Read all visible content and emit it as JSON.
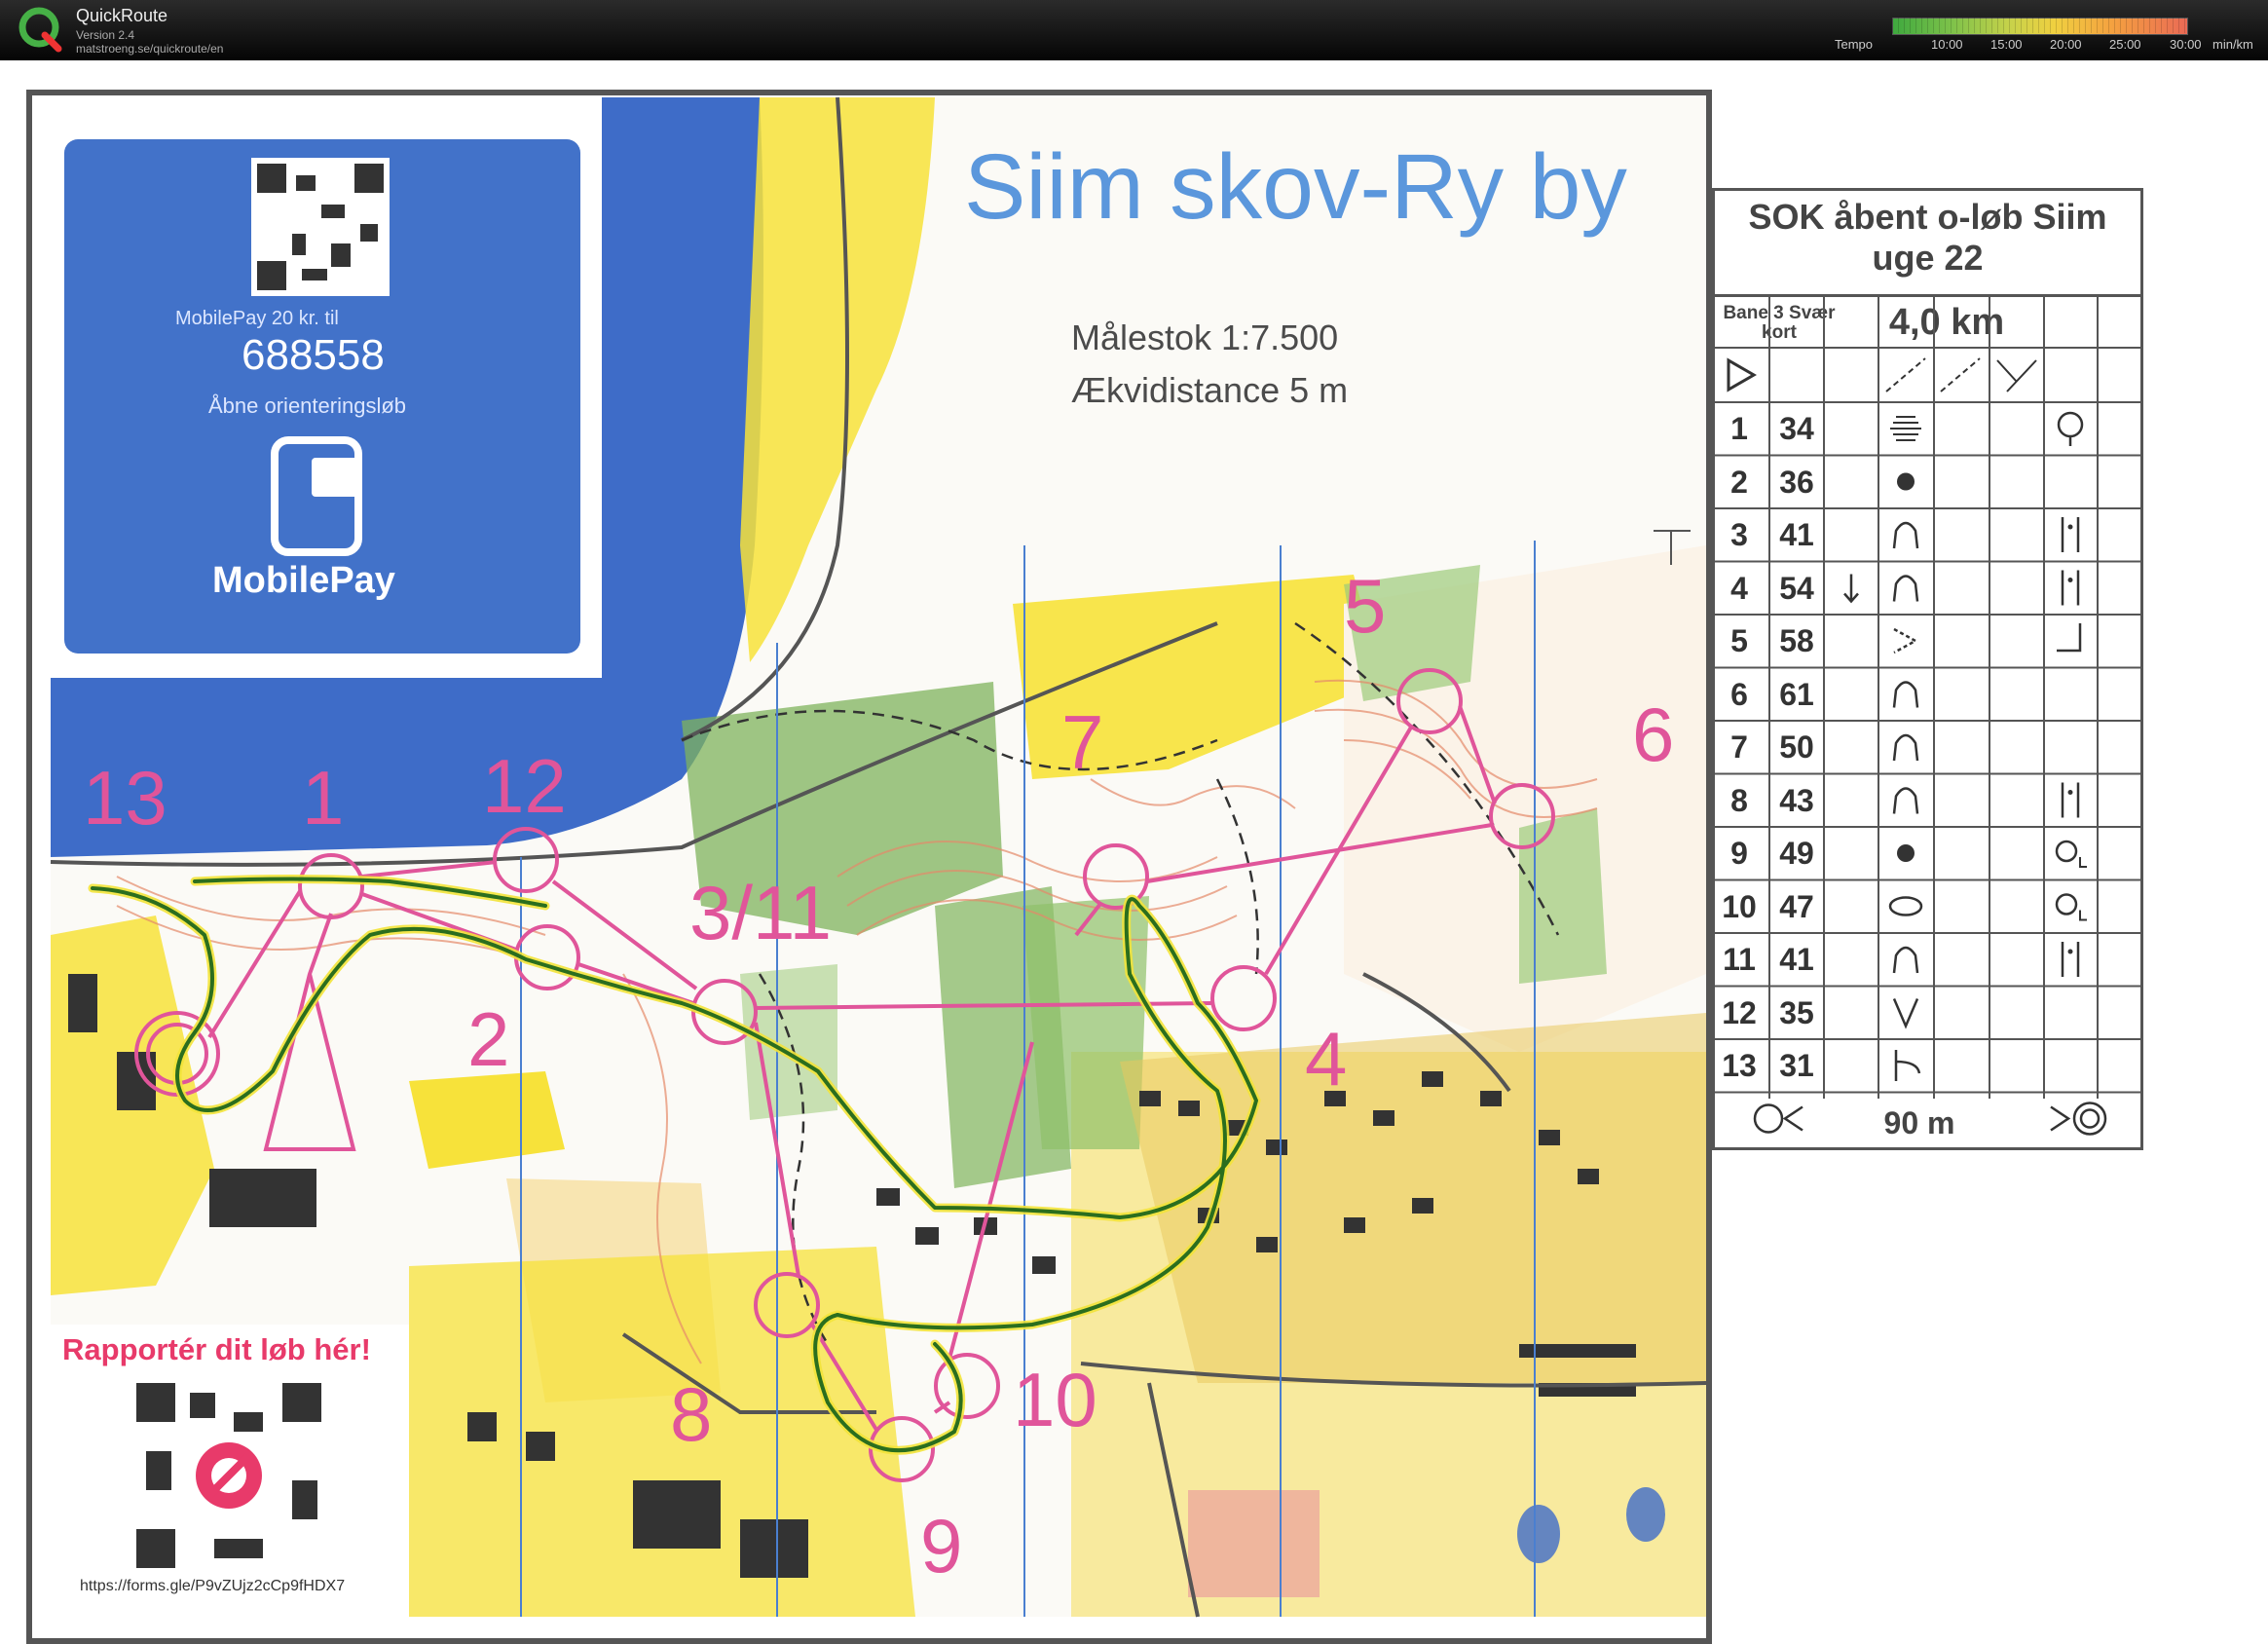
{
  "app": {
    "title": "QuickRoute",
    "version": "Version 2.4",
    "url": "matstroeng.se/quickroute/en",
    "tempo_label": "Tempo",
    "tempo_ticks": [
      "10:00",
      "15:00",
      "20:00",
      "25:00",
      "30:00"
    ],
    "tempo_unit": "min/km"
  },
  "map": {
    "title": "Siim skov-Ry by",
    "scale": "Målestok 1:7.500",
    "equidistance": "Ækvidistance 5 m",
    "colors": {
      "water": "#3e6cc8",
      "open": "#f7e23a",
      "forest": "#7fb35c",
      "course": "#e0559a",
      "route": "#2b6e1e",
      "contour": "#e58a6a"
    },
    "mobilepay": {
      "amount_text": "MobilePay 20 kr. til",
      "number": "688558",
      "description": "Åbne orienteringsløb",
      "brand": "MobilePay"
    },
    "report": {
      "title": "Rapportér dit løb hér!",
      "url": "https://forms.gle/P9vZUjz2cCp9fHDX7"
    },
    "control_labels": [
      "13",
      "1",
      "12",
      "3/11",
      "2",
      "7",
      "5",
      "6",
      "4",
      "8",
      "10",
      "9"
    ]
  },
  "description_sheet": {
    "event": [
      "SOK åbent o-løb Siim",
      "uge 22"
    ],
    "course": [
      "Bane 3 Svær",
      "kort"
    ],
    "length": "4,0 km",
    "rows": [
      {
        "n": "1",
        "code": "34",
        "feature": "terrace-icon",
        "detail": "waterhole-icon"
      },
      {
        "n": "2",
        "code": "36",
        "feature": "knoll-icon",
        "detail": ""
      },
      {
        "n": "3",
        "code": "41",
        "feature": "depression-icon",
        "detail": "foot-icon"
      },
      {
        "n": "4",
        "code": "54",
        "feature": "depression-icon",
        "detail": "foot-icon"
      },
      {
        "n": "5",
        "code": "58",
        "feature": "gully-icon",
        "detail": "corner-icon"
      },
      {
        "n": "6",
        "code": "61",
        "feature": "depression-icon",
        "detail": ""
      },
      {
        "n": "7",
        "code": "50",
        "feature": "depression-icon",
        "detail": ""
      },
      {
        "n": "8",
        "code": "43",
        "feature": "depression-icon",
        "detail": "foot-icon"
      },
      {
        "n": "9",
        "code": "49",
        "feature": "knoll-icon",
        "detail": "small-circle-icon"
      },
      {
        "n": "10",
        "code": "47",
        "feature": "ellipse-icon",
        "detail": "small-circle-icon"
      },
      {
        "n": "11",
        "code": "41",
        "feature": "depression-icon",
        "detail": "foot-icon"
      },
      {
        "n": "12",
        "code": "35",
        "feature": "v-icon",
        "detail": ""
      },
      {
        "n": "13",
        "code": "31",
        "feature": "pipe-icon",
        "detail": ""
      }
    ],
    "finish": "90 m"
  }
}
